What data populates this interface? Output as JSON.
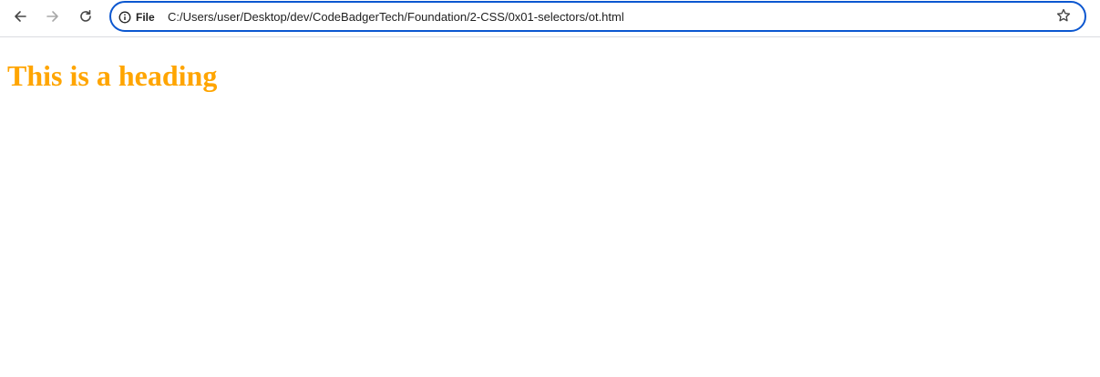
{
  "browser": {
    "site_info_label": "File",
    "url": "C:/Users/user/Desktop/dev/CodeBadgerTech/Foundation/2-CSS/0x01-selectors/ot.html",
    "icons": {
      "back": "arrow-left-icon",
      "forward": "arrow-right-icon",
      "reload": "reload-icon",
      "site_info": "info-icon",
      "bookmark": "star-icon"
    },
    "accent_color": "#0b57d0"
  },
  "page": {
    "heading": "This is a heading",
    "heading_color": "#ffa500"
  }
}
